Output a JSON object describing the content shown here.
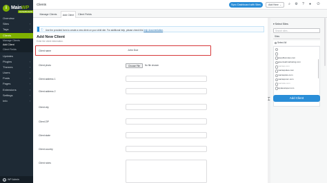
{
  "brand": {
    "logo_glyph": "i",
    "name_a": "Main",
    "name_b": "WP",
    "badge": "DASHBOARD"
  },
  "sidebar": {
    "items": [
      {
        "label": "Overview",
        "chevron": ""
      },
      {
        "label": "Sites",
        "chevron": "›"
      },
      {
        "label": "Tags",
        "chevron": "›"
      },
      {
        "label": "Clients",
        "chevron": "⌄"
      }
    ],
    "client_subs": [
      "Manage Clients",
      "Add Client",
      "Client Fields"
    ],
    "items_after": [
      {
        "label": "Updates",
        "chevron": ""
      },
      {
        "label": "Plugins",
        "chevron": "›"
      },
      {
        "label": "Themes",
        "chevron": "›"
      },
      {
        "label": "Users",
        "chevron": "›"
      },
      {
        "label": "Posts",
        "chevron": "›"
      },
      {
        "label": "Pages",
        "chevron": "›"
      },
      {
        "label": "Extensions",
        "chevron": "›"
      },
      {
        "label": "Settings",
        "chevron": "›"
      },
      {
        "label": "Info",
        "chevron": "›"
      }
    ],
    "wp_admin": "WP Admin"
  },
  "topbar": {
    "title": "Clients",
    "sync_label": "Sync Dashboard with Sites",
    "add_new_label": "Add New",
    "add_new_chevron": "⌄"
  },
  "tabs": [
    "Manage Clients",
    "Add Client",
    "Client Fields"
  ],
  "info": {
    "icon": "ⓘ",
    "text": "Use the provided form to create a new client on your child site. For additional help, please check this",
    "link": "help documentation",
    "after": "."
  },
  "form": {
    "title": "Add New Client",
    "subtitle": "Enter the client information.",
    "client_name_label": "Client name",
    "client_name_value": "John Doe",
    "photo_label": "Client photo",
    "file_button": "Choose File",
    "file_none": "No file chosen",
    "labels": [
      "Client address 1",
      "Client address 2",
      "Client city",
      "Client ZIP",
      "Client state",
      "Client country",
      "Client notes"
    ]
  },
  "right": {
    "title": "▾ Select Sites",
    "search_placeholder": "Search sites ...",
    "filter_label": "Sites",
    "select_all": "Select All",
    "sites": [
      {
        "label": "",
        "muted": true
      },
      {
        "label": "",
        "muted": true
      },
      {
        "label": "wavyfilocuries.com",
        "muted": false
      },
      {
        "label": "greenwebmarketing.com",
        "muted": false
      },
      {
        "label": "mainwp.com",
        "muted": true
      },
      {
        "label": "mainwpsites.com",
        "muted": false
      },
      {
        "label": "mainwpdev.com",
        "muted": false
      },
      {
        "label": "mainwpcom.com",
        "muted": false
      },
      {
        "label": "mainsite.com",
        "muted": true
      },
      {
        "label": "wpdeveloper.com",
        "muted": false
      }
    ],
    "add_button": "Add Client"
  }
}
